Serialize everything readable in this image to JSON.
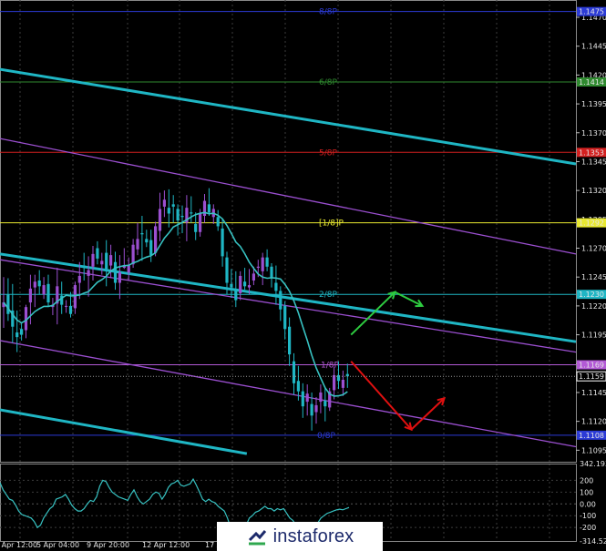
{
  "chart_data": [
    {
      "type": "candlestick",
      "instrument_label": "",
      "y_range": [
        1.1085,
        1.1485
      ],
      "price_ticks": [
        "1.1470",
        "1.1445",
        "1.1420",
        "1.1395",
        "1.1370",
        "1.1345",
        "1.1320",
        "1.1295",
        "1.1270",
        "1.1245",
        "1.1220",
        "1.1195",
        "1.1170",
        "1.1145",
        "1.1120",
        "1.1095"
      ],
      "x_ticks": [
        "2 Apr 12:00",
        "5 Apr 04:00",
        "9 Apr 20:00",
        "12 Apr 12:00",
        "17 Apr"
      ],
      "murray_levels": [
        {
          "label": "8/8P",
          "value": 1.1475,
          "color": "#2c3bd6"
        },
        {
          "label": "6/8P",
          "value": 1.1414,
          "color": "#2f8a2f"
        },
        {
          "label": "5/8P",
          "value": 1.1353,
          "color": "#d42020"
        },
        {
          "label": "[1/8]P",
          "value": 1.1292,
          "color": "#e8e830"
        },
        {
          "label": "2/8P",
          "value": 1.123,
          "color": "#1fb6c4"
        },
        {
          "label": "1/8P",
          "value": 1.1169,
          "color": "#b35ad6"
        },
        {
          "label": "0/8P",
          "value": 1.1108,
          "color": "#2c3bd6"
        }
      ],
      "price_badges": [
        {
          "text": "1.1475",
          "color": "#2c3bd6"
        },
        {
          "text": "1.1414",
          "color": "#2f8a2f"
        },
        {
          "text": "1.1353",
          "color": "#d42020"
        },
        {
          "text": "1.1292",
          "color": "#e8e830"
        },
        {
          "text": "1.1230",
          "color": "#1fb6c4"
        },
        {
          "text": "1.1169",
          "color": "#b35ad6"
        },
        {
          "text": "1.1159",
          "color": "#ffffff"
        },
        {
          "text": "1.1108",
          "color": "#2c3bd6"
        }
      ],
      "current_price": 1.1159,
      "moving_average_color": "#37c2c2",
      "candle_colors": {
        "up": "#9b4fd0",
        "down": "#1fb6c4"
      },
      "trend_channels": [
        {
          "color": "#1fb6c4",
          "p1": [
            0,
            1.1425
          ],
          "p2": [
            105,
            1.1343
          ]
        },
        {
          "color": "#1fb6c4",
          "p1": [
            0,
            1.1265
          ],
          "p2": [
            105,
            1.1189
          ]
        },
        {
          "color": "#1fb6c4",
          "p1": [
            0,
            1.113
          ],
          "p2": [
            45,
            1.1092
          ]
        },
        {
          "color": "#9b4fd0",
          "p1": [
            0,
            1.1365
          ],
          "p2": [
            105,
            1.1265
          ]
        },
        {
          "color": "#9b4fd0",
          "p1": [
            0,
            1.126
          ],
          "p2": [
            105,
            1.118
          ]
        },
        {
          "color": "#9b4fd0",
          "p1": [
            0,
            1.119
          ],
          "p2": [
            105,
            1.1098
          ]
        }
      ],
      "forecast_up": {
        "color": "#2ecc40",
        "points": [
          [
            64,
            1.1195
          ],
          [
            72,
            1.1232
          ],
          [
            77,
            1.122
          ]
        ]
      },
      "forecast_down": {
        "color": "#e01010",
        "points": [
          [
            64,
            1.1172
          ],
          [
            75,
            1.1113
          ],
          [
            81,
            1.114
          ]
        ]
      },
      "candles": [
        {
          "o": 1.1219,
          "h": 1.1245,
          "l": 1.1201,
          "c": 1.1223
        },
        {
          "o": 1.123,
          "h": 1.1244,
          "l": 1.1207,
          "c": 1.1213
        },
        {
          "o": 1.1216,
          "h": 1.1239,
          "l": 1.1188,
          "c": 1.1202
        },
        {
          "o": 1.1197,
          "h": 1.1216,
          "l": 1.118,
          "c": 1.1193
        },
        {
          "o": 1.12,
          "h": 1.1206,
          "l": 1.119,
          "c": 1.1195
        },
        {
          "o": 1.1199,
          "h": 1.1221,
          "l": 1.1192,
          "c": 1.1219
        },
        {
          "o": 1.1223,
          "h": 1.1247,
          "l": 1.1204,
          "c": 1.1235
        },
        {
          "o": 1.1236,
          "h": 1.1247,
          "l": 1.1219,
          "c": 1.1241
        },
        {
          "o": 1.1242,
          "h": 1.1251,
          "l": 1.123,
          "c": 1.1237
        },
        {
          "o": 1.123,
          "h": 1.1245,
          "l": 1.1226,
          "c": 1.1238
        },
        {
          "o": 1.1239,
          "h": 1.1247,
          "l": 1.1219,
          "c": 1.1223
        },
        {
          "o": 1.1219,
          "h": 1.1227,
          "l": 1.1212,
          "c": 1.1221
        },
        {
          "o": 1.1222,
          "h": 1.1253,
          "l": 1.1204,
          "c": 1.1237
        },
        {
          "o": 1.1229,
          "h": 1.1241,
          "l": 1.1213,
          "c": 1.1221
        },
        {
          "o": 1.122,
          "h": 1.1225,
          "l": 1.1214,
          "c": 1.122
        },
        {
          "o": 1.122,
          "h": 1.1232,
          "l": 1.121,
          "c": 1.1213
        },
        {
          "o": 1.1218,
          "h": 1.1241,
          "l": 1.1213,
          "c": 1.1238
        },
        {
          "o": 1.124,
          "h": 1.1258,
          "l": 1.1226,
          "c": 1.1246
        },
        {
          "o": 1.1255,
          "h": 1.1266,
          "l": 1.1242,
          "c": 1.1253
        },
        {
          "o": 1.1246,
          "h": 1.1263,
          "l": 1.1228,
          "c": 1.1251
        },
        {
          "o": 1.1254,
          "h": 1.1272,
          "l": 1.1242,
          "c": 1.1265
        },
        {
          "o": 1.127,
          "h": 1.1276,
          "l": 1.1256,
          "c": 1.1261
        },
        {
          "o": 1.1256,
          "h": 1.1266,
          "l": 1.1247,
          "c": 1.1259
        },
        {
          "o": 1.1266,
          "h": 1.1277,
          "l": 1.1237,
          "c": 1.1252
        },
        {
          "o": 1.1255,
          "h": 1.1273,
          "l": 1.1244,
          "c": 1.1264
        },
        {
          "o": 1.1258,
          "h": 1.1267,
          "l": 1.1234,
          "c": 1.124
        },
        {
          "o": 1.124,
          "h": 1.1264,
          "l": 1.1226,
          "c": 1.1249
        },
        {
          "o": 1.1253,
          "h": 1.127,
          "l": 1.1252,
          "c": 1.1255
        },
        {
          "o": 1.1249,
          "h": 1.1262,
          "l": 1.1242,
          "c": 1.1255
        },
        {
          "o": 1.1256,
          "h": 1.1278,
          "l": 1.1253,
          "c": 1.1273
        },
        {
          "o": 1.1269,
          "h": 1.1292,
          "l": 1.1264,
          "c": 1.1278
        },
        {
          "o": 1.1283,
          "h": 1.1298,
          "l": 1.1259,
          "c": 1.1282
        },
        {
          "o": 1.1278,
          "h": 1.1286,
          "l": 1.1271,
          "c": 1.1275
        },
        {
          "o": 1.1277,
          "h": 1.1286,
          "l": 1.1258,
          "c": 1.1264
        },
        {
          "o": 1.1266,
          "h": 1.1293,
          "l": 1.1263,
          "c": 1.1289
        },
        {
          "o": 1.1285,
          "h": 1.1318,
          "l": 1.1276,
          "c": 1.1304
        },
        {
          "o": 1.1306,
          "h": 1.132,
          "l": 1.1297,
          "c": 1.1312
        },
        {
          "o": 1.1305,
          "h": 1.1321,
          "l": 1.1288,
          "c": 1.13
        },
        {
          "o": 1.1308,
          "h": 1.1316,
          "l": 1.1292,
          "c": 1.1306
        },
        {
          "o": 1.1304,
          "h": 1.1308,
          "l": 1.1281,
          "c": 1.1294
        },
        {
          "o": 1.1298,
          "h": 1.1307,
          "l": 1.1283,
          "c": 1.1297
        },
        {
          "o": 1.1292,
          "h": 1.1316,
          "l": 1.1276,
          "c": 1.1305
        },
        {
          "o": 1.1301,
          "h": 1.1315,
          "l": 1.1292,
          "c": 1.13
        },
        {
          "o": 1.1291,
          "h": 1.1301,
          "l": 1.1277,
          "c": 1.1284
        },
        {
          "o": 1.1284,
          "h": 1.1304,
          "l": 1.128,
          "c": 1.13
        },
        {
          "o": 1.1298,
          "h": 1.1317,
          "l": 1.1292,
          "c": 1.1311
        },
        {
          "o": 1.1308,
          "h": 1.1322,
          "l": 1.1298,
          "c": 1.1301
        },
        {
          "o": 1.1297,
          "h": 1.1308,
          "l": 1.1291,
          "c": 1.1304
        },
        {
          "o": 1.1297,
          "h": 1.1303,
          "l": 1.1285,
          "c": 1.1289
        },
        {
          "o": 1.1287,
          "h": 1.1295,
          "l": 1.1254,
          "c": 1.1263
        },
        {
          "o": 1.1262,
          "h": 1.1267,
          "l": 1.123,
          "c": 1.124
        },
        {
          "o": 1.1239,
          "h": 1.1252,
          "l": 1.1227,
          "c": 1.1236
        },
        {
          "o": 1.1234,
          "h": 1.125,
          "l": 1.1219,
          "c": 1.1225
        },
        {
          "o": 1.1231,
          "h": 1.125,
          "l": 1.1225,
          "c": 1.1246
        },
        {
          "o": 1.1241,
          "h": 1.1253,
          "l": 1.1234,
          "c": 1.1237
        },
        {
          "o": 1.1236,
          "h": 1.1252,
          "l": 1.123,
          "c": 1.1238
        },
        {
          "o": 1.1242,
          "h": 1.1254,
          "l": 1.1238,
          "c": 1.1248
        },
        {
          "o": 1.1253,
          "h": 1.126,
          "l": 1.1245,
          "c": 1.1254
        },
        {
          "o": 1.125,
          "h": 1.1266,
          "l": 1.1238,
          "c": 1.1262
        },
        {
          "o": 1.1262,
          "h": 1.1269,
          "l": 1.125,
          "c": 1.1254
        },
        {
          "o": 1.1254,
          "h": 1.1257,
          "l": 1.1236,
          "c": 1.1244
        },
        {
          "o": 1.124,
          "h": 1.1255,
          "l": 1.1221,
          "c": 1.1233
        },
        {
          "o": 1.1233,
          "h": 1.1237,
          "l": 1.1207,
          "c": 1.1217
        },
        {
          "o": 1.122,
          "h": 1.1224,
          "l": 1.1191,
          "c": 1.12
        },
        {
          "o": 1.1202,
          "h": 1.121,
          "l": 1.1168,
          "c": 1.1178
        },
        {
          "o": 1.1172,
          "h": 1.1179,
          "l": 1.1143,
          "c": 1.1153
        },
        {
          "o": 1.1155,
          "h": 1.1168,
          "l": 1.1138,
          "c": 1.1146
        },
        {
          "o": 1.1146,
          "h": 1.1153,
          "l": 1.1123,
          "c": 1.1133
        },
        {
          "o": 1.1137,
          "h": 1.1152,
          "l": 1.1125,
          "c": 1.1144
        },
        {
          "o": 1.1135,
          "h": 1.1145,
          "l": 1.1112,
          "c": 1.1125
        },
        {
          "o": 1.1128,
          "h": 1.1141,
          "l": 1.1118,
          "c": 1.1134
        },
        {
          "o": 1.1137,
          "h": 1.1152,
          "l": 1.1127,
          "c": 1.1145
        },
        {
          "o": 1.1138,
          "h": 1.115,
          "l": 1.112,
          "c": 1.1133
        },
        {
          "o": 1.1132,
          "h": 1.1149,
          "l": 1.1129,
          "c": 1.1146
        },
        {
          "o": 1.1147,
          "h": 1.1167,
          "l": 1.1139,
          "c": 1.116
        },
        {
          "o": 1.116,
          "h": 1.1172,
          "l": 1.1148,
          "c": 1.1155
        },
        {
          "o": 1.1149,
          "h": 1.1164,
          "l": 1.1142,
          "c": 1.1156
        },
        {
          "o": 1.1161,
          "h": 1.117,
          "l": 1.1149,
          "c": 1.1159
        }
      ]
    },
    {
      "type": "line",
      "indicator_label": "",
      "y_range": [
        -314.5221,
        342.1937
      ],
      "y_ticks": [
        "342.1937",
        "200",
        "100",
        "0.00",
        "-100",
        "-200",
        "-314.5221"
      ],
      "zero_value": 0,
      "values": [
        180,
        120,
        80,
        40,
        30,
        -10,
        -60,
        -90,
        -100,
        -110,
        -120,
        -150,
        -200,
        -180,
        -120,
        -80,
        -40,
        -20,
        40,
        50,
        60,
        80,
        40,
        -10,
        -40,
        -60,
        -60,
        -40,
        0,
        30,
        20,
        60,
        150,
        200,
        190,
        140,
        100,
        80,
        60,
        50,
        40,
        30,
        80,
        120,
        60,
        20,
        0,
        20,
        40,
        80,
        100,
        90,
        40,
        80,
        140,
        170,
        180,
        200,
        160,
        150,
        160,
        170,
        210,
        160,
        100,
        40,
        20,
        40,
        20,
        10,
        -20,
        -40,
        -60,
        -120,
        -200,
        -240,
        -260,
        -310,
        -260,
        -180,
        -120,
        -100,
        -70,
        -60,
        -40,
        -20,
        -40,
        -40,
        -60,
        -40,
        -50,
        -40,
        -80,
        -120,
        -140,
        -180,
        -220,
        -260,
        -300,
        -280,
        -200,
        -160,
        -160,
        -120,
        -100,
        -80,
        -70,
        -60,
        -50,
        -45,
        -50,
        -40,
        -30
      ]
    }
  ],
  "watermark": {
    "text": "instaforex"
  }
}
